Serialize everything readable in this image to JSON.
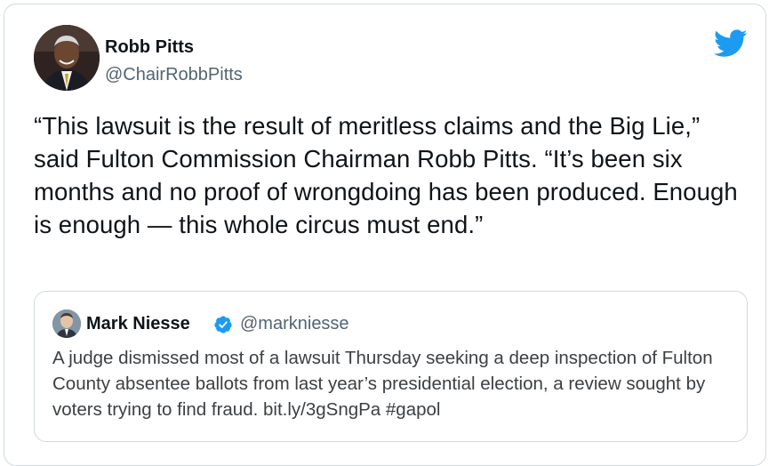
{
  "tweet": {
    "author_name": "Robb Pitts",
    "author_handle": "@ChairRobbPitts",
    "text": "“This lawsuit is the result of meritless claims and the Big Lie,” said Fulton Commission Chairman Robb Pitts. “It’s been six months and no proof of wrongdoing has been produced. Enough is enough — this whole circus must end.”"
  },
  "quoted": {
    "author_name": "Mark Niesse",
    "author_handle": "@markniesse",
    "verified": true,
    "text": "A judge dismissed most of a lawsuit Thursday seeking a deep inspection of Fulton County absentee ballots from last year’s presidential election, a review sought by voters trying to find fraud. bit.ly/3gSngPa #gapol"
  },
  "icons": {
    "brand": "twitter-bird-icon",
    "verified": "verified-badge-icon"
  },
  "colors": {
    "twitter_blue": "#1d9bf0",
    "border": "#cfd9de",
    "handle_gray": "#536471"
  }
}
